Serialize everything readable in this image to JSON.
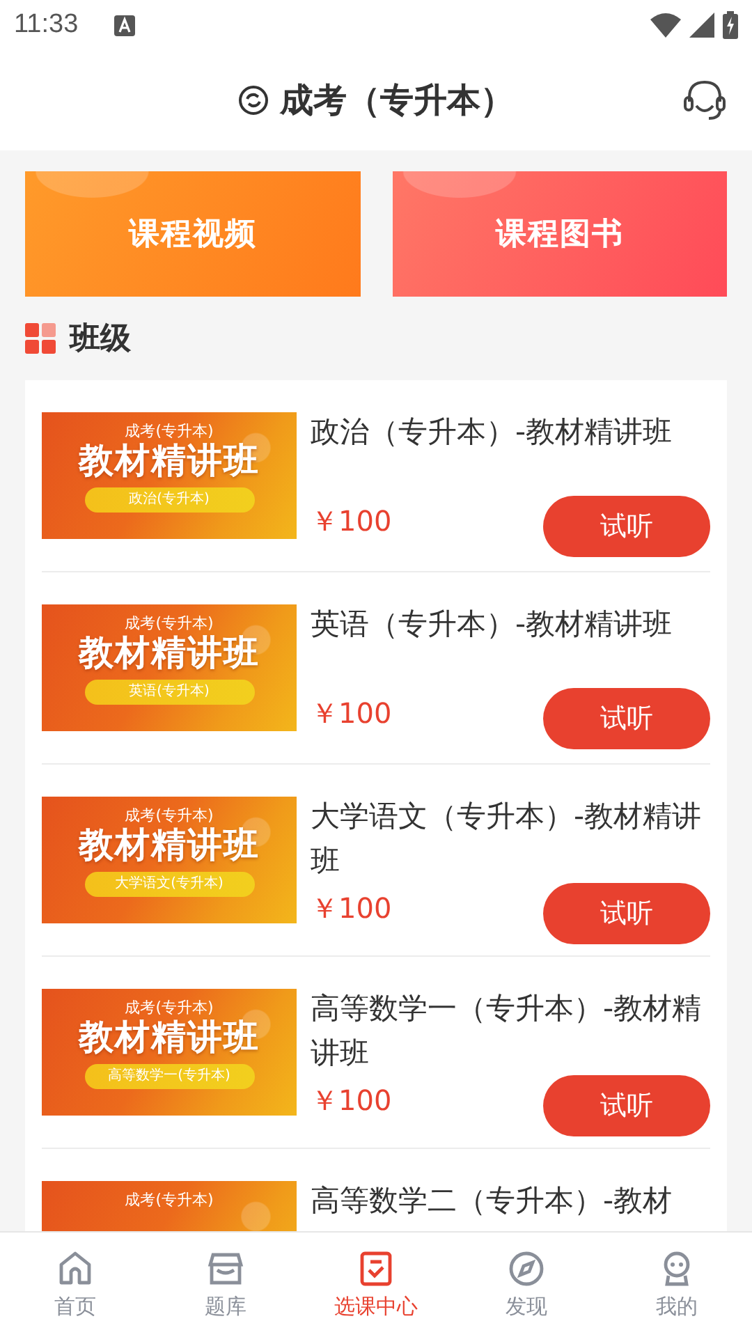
{
  "status_bar": {
    "time": "11:33"
  },
  "header": {
    "title": "成考（专升本）"
  },
  "shortcuts": [
    {
      "label": "课程视频",
      "kind": "video"
    },
    {
      "label": "课程图书",
      "kind": "book"
    }
  ],
  "section": {
    "title": "班级"
  },
  "courses": [
    {
      "title": "政治（专升本）-教材精讲班",
      "thumb": {
        "exam": "成考(专升本)",
        "series": "教材精讲班",
        "subject": "政治(专升本)"
      },
      "price": "￥100",
      "button": "试听"
    },
    {
      "title": "英语（专升本）-教材精讲班",
      "thumb": {
        "exam": "成考(专升本)",
        "series": "教材精讲班",
        "subject": "英语(专升本)"
      },
      "price": "￥100",
      "button": "试听"
    },
    {
      "title": "大学语文（专升本）-教材精讲班",
      "thumb": {
        "exam": "成考(专升本)",
        "series": "教材精讲班",
        "subject": "大学语文(专升本)"
      },
      "price": "￥100",
      "button": "试听"
    },
    {
      "title": "高等数学一（专升本）-教材精讲班",
      "thumb": {
        "exam": "成考(专升本)",
        "series": "教材精讲班",
        "subject": "高等数学一(专升本)"
      },
      "price": "￥100",
      "button": "试听"
    },
    {
      "title": "高等数学二（专升本）-教材",
      "thumb": {
        "exam": "成考(专升本)"
      }
    }
  ],
  "tabs": [
    {
      "label": "首页",
      "kind": "home",
      "selected": false
    },
    {
      "label": "题库",
      "kind": "bank",
      "selected": false
    },
    {
      "label": "选课中心",
      "kind": "courses",
      "selected": true
    },
    {
      "label": "发现",
      "kind": "discover",
      "selected": false
    },
    {
      "label": "我的",
      "kind": "me",
      "selected": false
    }
  ]
}
